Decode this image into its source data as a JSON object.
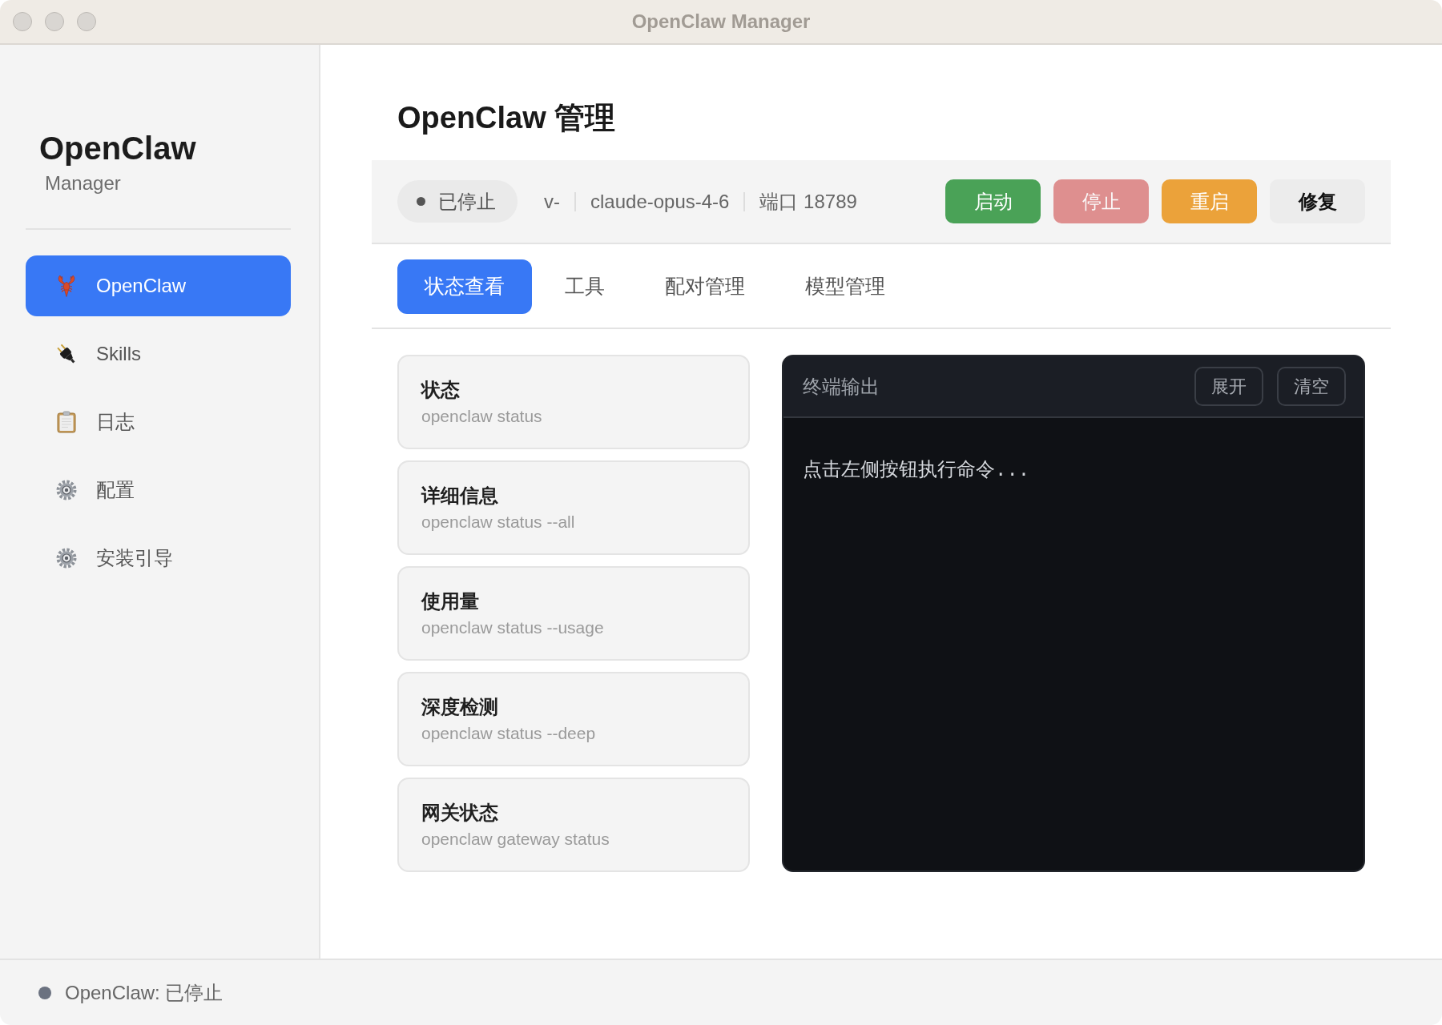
{
  "window": {
    "title": "OpenClaw Manager"
  },
  "sidebar": {
    "brand": {
      "title": "OpenClaw",
      "subtitle": "Manager"
    },
    "items": [
      {
        "label": "OpenClaw",
        "selected": true
      },
      {
        "label": "Skills",
        "selected": false
      },
      {
        "label": "日志",
        "selected": false
      },
      {
        "label": "配置",
        "selected": false
      },
      {
        "label": "安装引导",
        "selected": false
      }
    ]
  },
  "page": {
    "title": "OpenClaw 管理"
  },
  "service_bar": {
    "status": {
      "label": "已停止",
      "running": false
    },
    "version": "v-",
    "model": "claude-opus-4-6",
    "port": "端口 18789",
    "buttons": [
      {
        "label": "启动",
        "kind": "success",
        "disabled": false
      },
      {
        "label": "停止",
        "kind": "danger",
        "disabled": true
      },
      {
        "label": "重启",
        "kind": "warning",
        "disabled": false
      },
      {
        "label": "修复",
        "kind": "neutral",
        "disabled": false
      }
    ]
  },
  "tabs": [
    {
      "label": "状态查看",
      "selected": true
    },
    {
      "label": "工具",
      "selected": false
    },
    {
      "label": "配对管理",
      "selected": false
    },
    {
      "label": "模型管理",
      "selected": false
    }
  ],
  "commands": [
    {
      "title": "状态",
      "command": "openclaw status"
    },
    {
      "title": "详细信息",
      "command": "openclaw status --all"
    },
    {
      "title": "使用量",
      "command": "openclaw status --usage"
    },
    {
      "title": "深度检测",
      "command": "openclaw status --deep"
    },
    {
      "title": "网关状态",
      "command": "openclaw gateway status"
    }
  ],
  "terminal": {
    "title": "终端输出",
    "buttons": [
      "展开",
      "清空"
    ],
    "output": "点击左侧按钮执行命令..."
  },
  "status_bar": {
    "text": "OpenClaw: 已停止",
    "running": false
  }
}
